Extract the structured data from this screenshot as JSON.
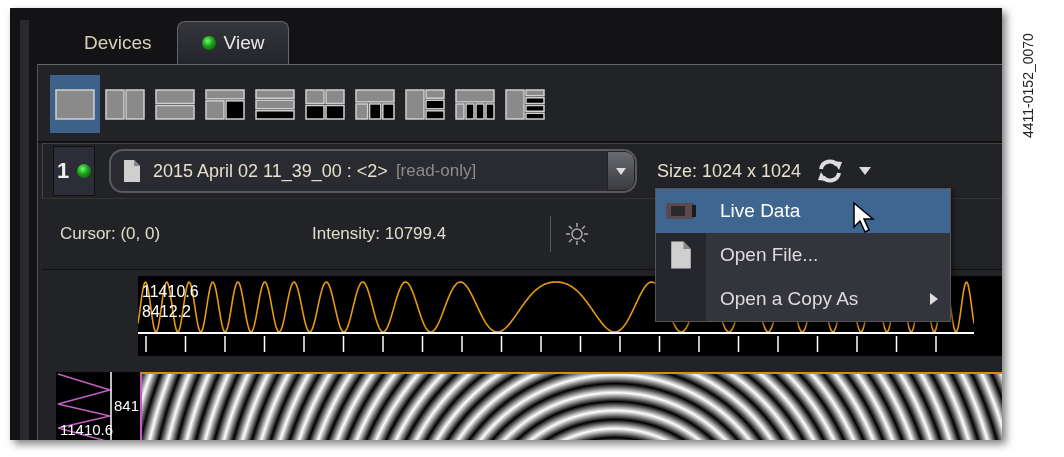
{
  "tabs": [
    {
      "label": "Devices",
      "selected": false,
      "indicator": false
    },
    {
      "label": "View",
      "selected": true,
      "indicator": true
    }
  ],
  "layouts": [
    {
      "kind": "single",
      "selected": true
    },
    {
      "kind": "two-columns",
      "selected": false
    },
    {
      "kind": "two-rows",
      "selected": false
    },
    {
      "kind": "top-split",
      "selected": false
    },
    {
      "kind": "three-rows",
      "selected": false
    },
    {
      "kind": "quad",
      "selected": false
    },
    {
      "kind": "top-three",
      "selected": false
    },
    {
      "kind": "side-stack",
      "selected": false
    },
    {
      "kind": "top-four",
      "selected": false
    },
    {
      "kind": "side-four",
      "selected": false
    }
  ],
  "viewport": {
    "number": "1",
    "active": true
  },
  "file": {
    "name": "2015 April 02 11_39_00 : <2>",
    "note": "[read-only]"
  },
  "size": "Size: 1024 x 1024",
  "status": {
    "cursor": "Cursor: (0, 0)",
    "intensity": "Intensity: 10799.4"
  },
  "profile": {
    "max": "11410.6",
    "min": "8412.2"
  },
  "side_profile": {
    "min": "841",
    "max": "11410.6"
  },
  "menu": [
    {
      "label": "Live Data",
      "kind": "camera",
      "selected": true
    },
    {
      "label": "Open File...",
      "kind": "file",
      "selected": false
    },
    {
      "label": "Open a Copy As",
      "kind": "submenu",
      "selected": false
    }
  ],
  "figure_id": "4411-0152_0070"
}
